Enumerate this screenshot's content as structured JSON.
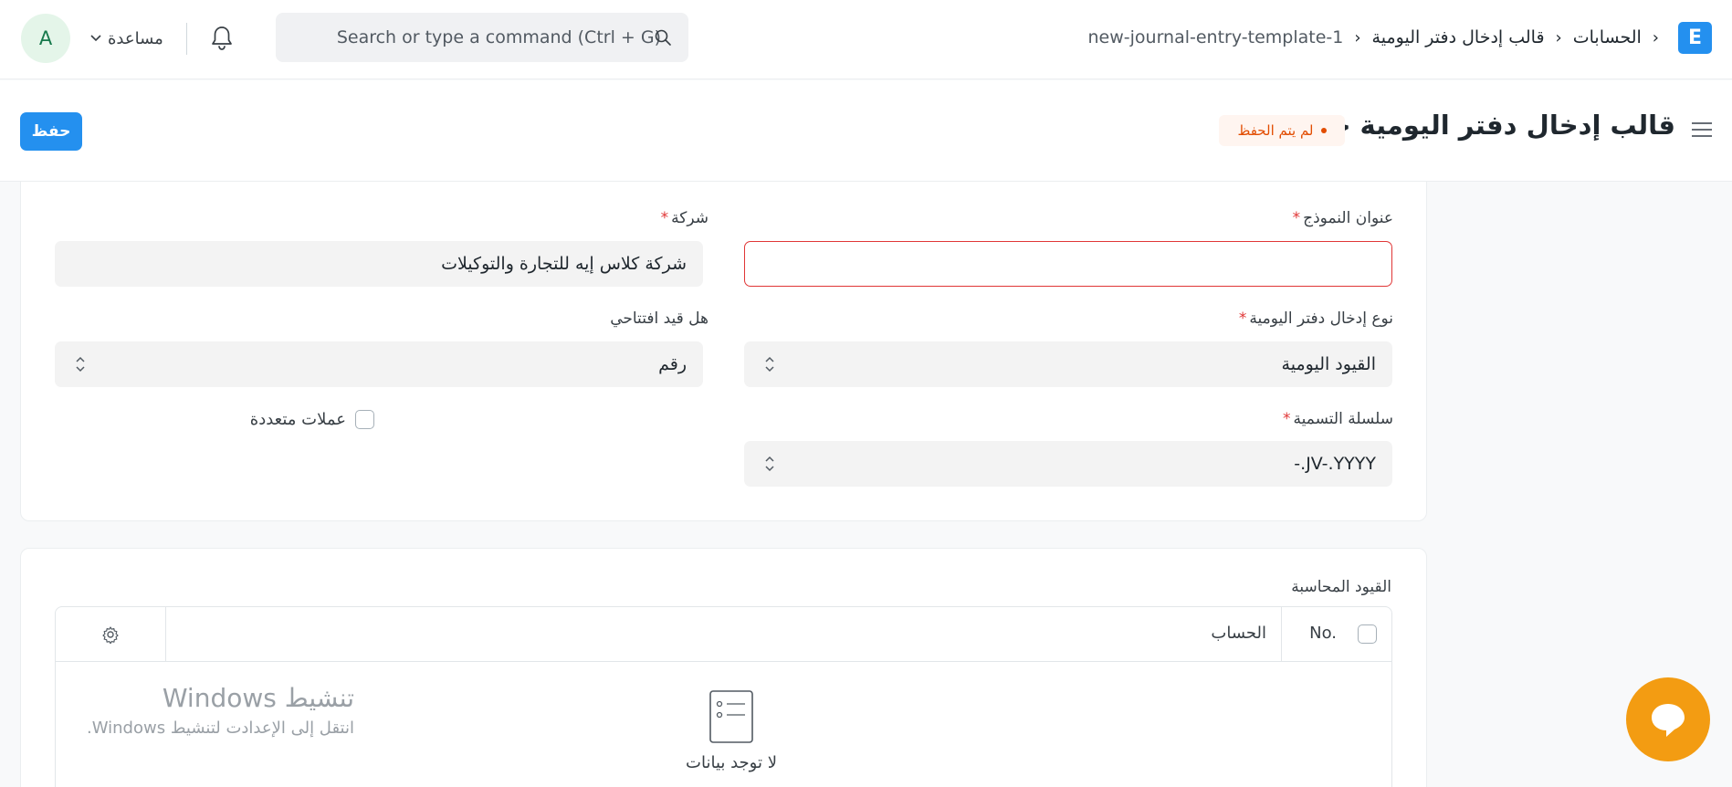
{
  "navbar": {
    "logo_letter": "E",
    "breadcrumbs": [
      "الحسابات",
      "قالب إدخال دفتر اليومية",
      "new-journal-entry-template-1"
    ],
    "breadcrumb_separator": "›",
    "search_placeholder": "Search or type a command (Ctrl + G)",
    "help_label": "مساعدة",
    "avatar_letter": "A"
  },
  "page_head": {
    "title": "قالب إدخال دفتر اليومية جديد",
    "status": "لم يتم الحفظ",
    "save_label": "حفظ"
  },
  "form": {
    "template_title": {
      "label": "عنوان النموذج",
      "value": ""
    },
    "company": {
      "label": "شركة",
      "value": "شركة كلاس إيه للتجارة والتوكيلات"
    },
    "entry_type": {
      "label": "نوع إدخال دفتر اليومية",
      "value": "القيود اليومية"
    },
    "is_opening": {
      "label": "هل قيد افتتاحي",
      "value": "رقم"
    },
    "naming_series": {
      "label": "سلسلة التسمية",
      "value": "-.JV-.YYYY"
    },
    "multi_currency": {
      "label": "عملات متعددة",
      "checked": false
    }
  },
  "accounts_table": {
    "label": "القيود المحاسبة",
    "columns": [
      "No.",
      "الحساب"
    ],
    "empty_text": "لا توجد بيانات"
  },
  "watermark": {
    "title": "تنشيط Windows",
    "subtitle": "انتقل إلى الإعدادت لتنشيط Windows."
  },
  "colors": {
    "primary": "#2490ef",
    "status_orange": "#e24c00",
    "chat_orange": "#f39c12",
    "required_red": "#e03636"
  }
}
